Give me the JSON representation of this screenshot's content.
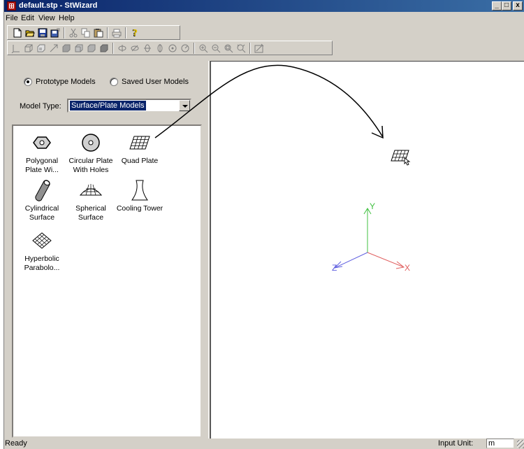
{
  "window": {
    "title": "default.stp - StWizard",
    "minimize_glyph": "_",
    "maximize_glyph": "□",
    "close_glyph": "x"
  },
  "menu": [
    "File",
    "Edit",
    "View",
    "Help"
  ],
  "toolbar_main": [
    "new-icon",
    "open-icon",
    "save-icon",
    "save-as-icon",
    "cut-icon",
    "copy-icon",
    "paste-icon",
    "print-icon",
    "help-icon"
  ],
  "toolbar_view": [
    "axis-icon",
    "box-view-icon",
    "iso-view-icon",
    "move-icon",
    "front-view-icon",
    "side-view-icon",
    "top-view-icon",
    "solid-view-icon",
    "rotate-x-icon",
    "rotate-y-icon",
    "rotate-z-icon",
    "rotate-zz-icon",
    "orbit-ccw-icon",
    "orbit-cw-icon",
    "zoom-in-icon",
    "zoom-out-icon",
    "zoom-window-icon",
    "zoom-fit-icon",
    "render-icon"
  ],
  "model_source": {
    "prototype_label": "Prototype Models",
    "saved_label": "Saved User Models",
    "selected": "prototype"
  },
  "model_type": {
    "label": "Model Type:",
    "value": "Surface/Plate Models"
  },
  "models": [
    {
      "label": "Polygonal Plate Wi...",
      "icon": "polygonal-plate-icon"
    },
    {
      "label": "Circular Plate With Holes",
      "icon": "circular-plate-icon"
    },
    {
      "label": "Quad Plate",
      "icon": "quad-plate-icon"
    },
    {
      "label": "Cylindrical Surface",
      "icon": "cylindrical-surface-icon"
    },
    {
      "label": "Spherical Surface",
      "icon": "spherical-surface-icon"
    },
    {
      "label": "Cooling Tower",
      "icon": "cooling-tower-icon"
    },
    {
      "label": "Hyperbolic Parabolo...",
      "icon": "hyperbolic-paraboloid-icon"
    }
  ],
  "view": {
    "axis_x": "X",
    "axis_y": "Y",
    "axis_z": "Z",
    "colors": {
      "x": "#e06060",
      "y": "#40c040",
      "z": "#6060e0"
    }
  },
  "status": {
    "text": "Ready",
    "input_unit_label": "Input Unit:",
    "input_unit_value": "m"
  }
}
